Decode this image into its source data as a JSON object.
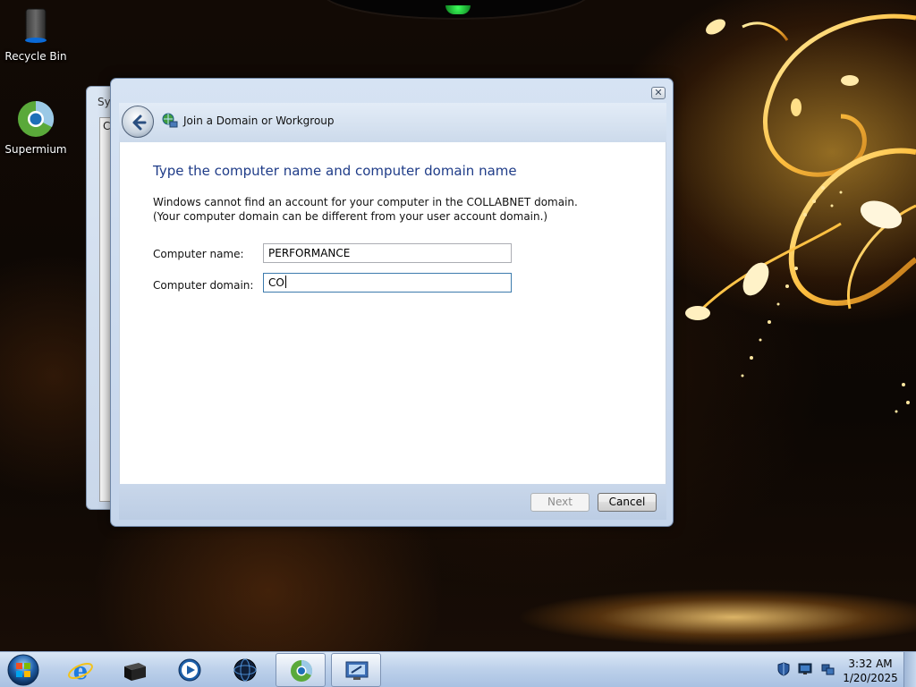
{
  "desktop": {
    "icons": [
      {
        "label": "Recycle Bin",
        "icon": "recycle-bin-icon"
      },
      {
        "label": "Supermium",
        "icon": "supermium-browser-icon"
      }
    ]
  },
  "background_window": {
    "title": "Sys",
    "inner_text": "C"
  },
  "dialog": {
    "title": "Join a Domain or Workgroup",
    "heading": "Type the computer name and computer domain name",
    "message": "Windows cannot find an account for your computer in the COLLABNET domain. (Your computer domain can be different from your user account domain.)",
    "fields": {
      "computer_name": {
        "label": "Computer name:",
        "value": "PERFORMANCE"
      },
      "computer_domain": {
        "label": "Computer domain:",
        "value": "CO"
      }
    },
    "buttons": {
      "next": "Next",
      "cancel": "Cancel"
    },
    "close_glyph": "✕"
  },
  "taskbar": {
    "pinned": [
      {
        "name": "internet-explorer-icon"
      },
      {
        "name": "terminal-icon"
      },
      {
        "name": "media-player-icon"
      },
      {
        "name": "network-globe-icon"
      },
      {
        "name": "supermium-browser-icon",
        "active": true
      },
      {
        "name": "remote-desktop-icon",
        "active": true
      }
    ],
    "tray": [
      "security-shield-icon",
      "display-icon",
      "network-icon"
    ],
    "clock": {
      "time": "3:32 AM",
      "date": "1/20/2025"
    }
  },
  "colors": {
    "heading": "#1f3c88",
    "dialog_frame": "#c5d5eb",
    "taskbar": "#bcd0ea"
  }
}
